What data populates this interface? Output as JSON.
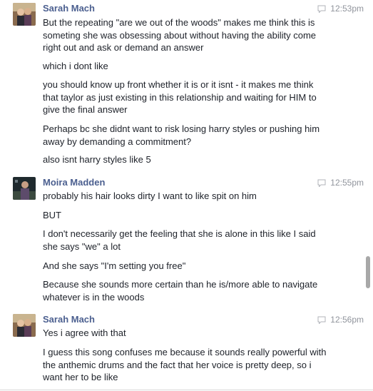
{
  "messages": [
    {
      "sender": "Sarah Mach",
      "time": "12:53pm",
      "paragraphs": [
        "But the repeating \"are we out of the woods\"  makes me think this is someting she was obsessing about without having the ability come right out and ask or demand an answer",
        "which i dont like",
        "you should know up front whether it is or it isnt - it makes me think that taylor as just existing in this relationship and waiting for HIM to give the final answer",
        "Perhaps bc she didnt want to risk losing harry styles or pushing him away by demanding a commitment?",
        "also isnt harry styles like 5"
      ]
    },
    {
      "sender": "Moira Madden",
      "time": "12:55pm",
      "paragraphs": [
        "probably his hair looks dirty I want to like spit on him",
        "BUT",
        "I don't necessarily get the feeling that she is alone in this like I said she says \"we\" a lot",
        "And she says \"I'm setting you free\"",
        "Because she sounds more certain than he is/more able to navigate whatever is in the woods"
      ]
    },
    {
      "sender": "Sarah Mach",
      "time": "12:56pm",
      "paragraphs": [
        "Yes i agree with that",
        "I guess this song confuses me because it sounds really powerful with the anthemic drums and the fact that her voice is pretty deep, so i want her to be like"
      ]
    }
  ],
  "icons": {
    "timestamp_icon": "chat-bubble-icon",
    "avatar_sarah": "user-photo-sarah",
    "avatar_moira": "user-photo-moira"
  },
  "colors": {
    "sender_name": "#4b5f8f",
    "timestamp": "#90949c",
    "text": "#1d2129"
  }
}
